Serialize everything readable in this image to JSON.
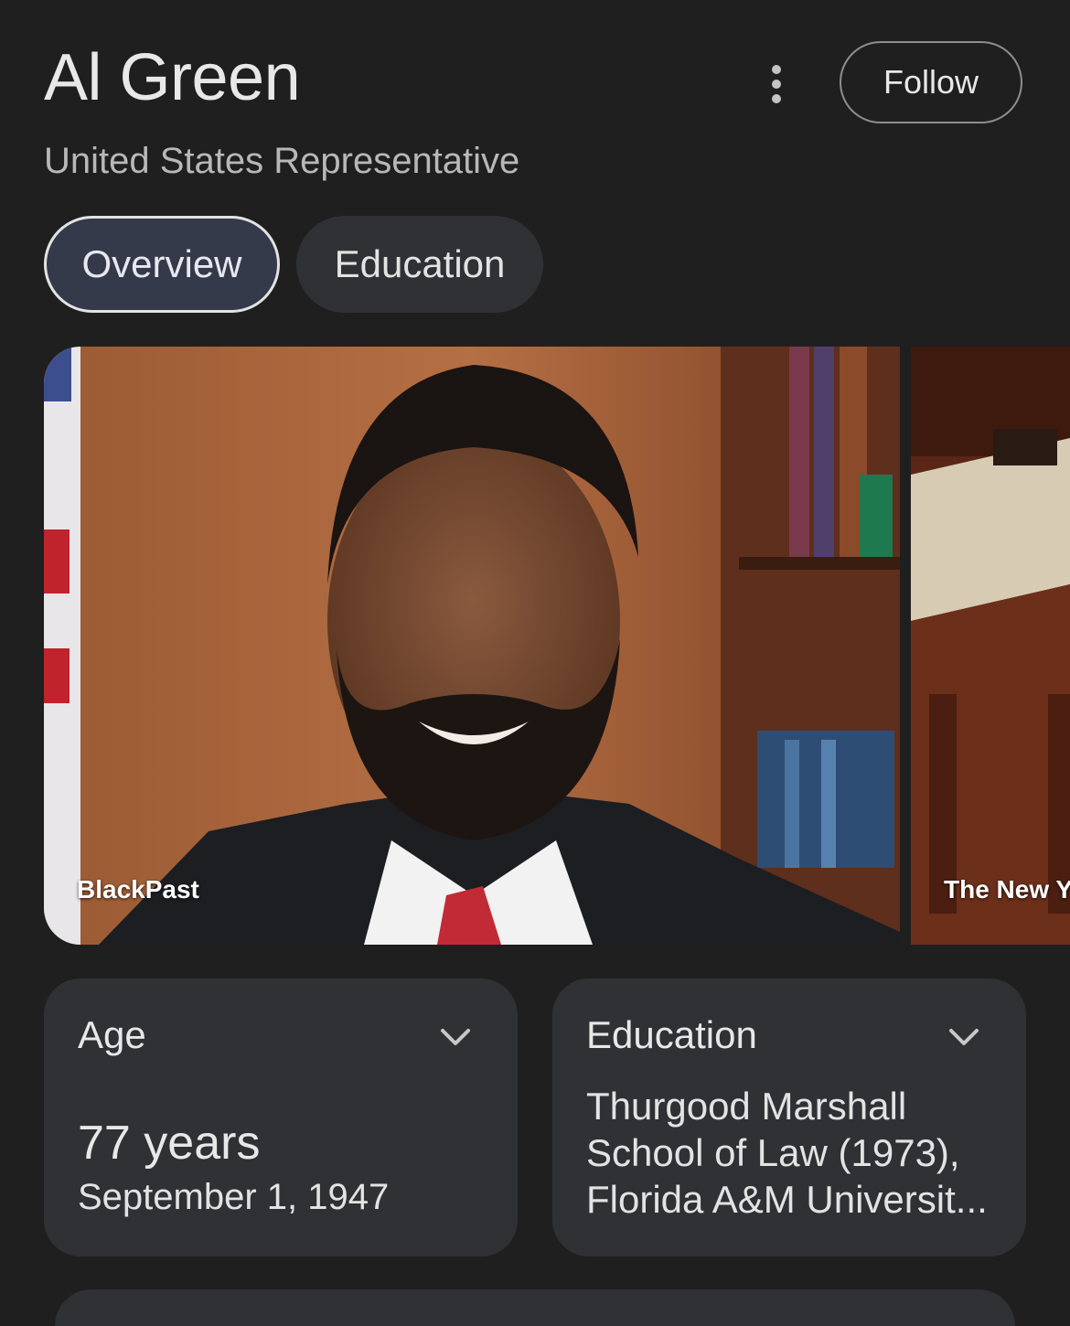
{
  "header": {
    "title": "Al Green",
    "subtitle": "United States Representative",
    "follow_label": "Follow"
  },
  "tabs": [
    {
      "label": "Overview",
      "active": true
    },
    {
      "label": "Education",
      "active": false
    }
  ],
  "images": [
    {
      "source": "BlackPast"
    },
    {
      "source": "The New Y"
    }
  ],
  "cards": {
    "age": {
      "label": "Age",
      "value": "77 years",
      "detail": "September 1, 1947"
    },
    "education": {
      "label": "Education",
      "value": "Thurgood Marshall School of Law (1973), Florida A&M Universit..."
    }
  },
  "colors": {
    "background": "#1f1f1f",
    "card": "#303134",
    "active_tab": "#353a4a"
  }
}
